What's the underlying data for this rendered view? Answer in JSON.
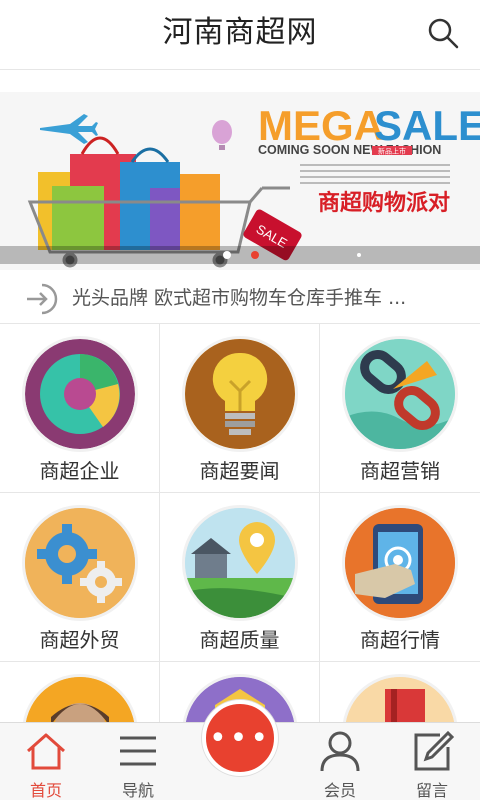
{
  "header": {
    "title": "河南商超网",
    "search_icon": "search-icon"
  },
  "banner": {
    "headline_mega": "MEGA",
    "headline_sale": "SALE",
    "subline": "COMING SOON NEW FASHION",
    "badge": "新品上市",
    "cn_slogan": "商超购物派对",
    "tag": "SALE",
    "slide_count": 3,
    "active_slide": 2
  },
  "ticker": {
    "icon": "enter-arrow-icon",
    "text": "光头品牌 欧式超市购物车仓库手推车 ..."
  },
  "grid": {
    "items": [
      {
        "label": "商超企业",
        "icon": "pie-chart-icon"
      },
      {
        "label": "商超要闻",
        "icon": "lightbulb-icon"
      },
      {
        "label": "商超营销",
        "icon": "chain-link-icon"
      },
      {
        "label": "商超外贸",
        "icon": "gears-icon"
      },
      {
        "label": "商超质量",
        "icon": "map-pin-icon"
      },
      {
        "label": "商超行情",
        "icon": "tablet-touch-icon"
      },
      {
        "label": "",
        "icon": "person-icon"
      },
      {
        "label": "",
        "icon": "folder-icon"
      },
      {
        "label": "",
        "icon": "book-icon"
      }
    ]
  },
  "bottom_nav": {
    "items": [
      {
        "label": "首页",
        "icon": "home-icon",
        "active": true
      },
      {
        "label": "导航",
        "icon": "menu-icon",
        "active": false
      },
      {
        "label": "会员",
        "icon": "user-icon",
        "active": false
      },
      {
        "label": "留言",
        "icon": "edit-icon",
        "active": false
      }
    ],
    "center_icon": "more-dots-icon",
    "center_label": "•••"
  },
  "colors": {
    "accent": "#e8412f",
    "active_nav": "#e24a3b",
    "border": "#e6e6e6"
  }
}
